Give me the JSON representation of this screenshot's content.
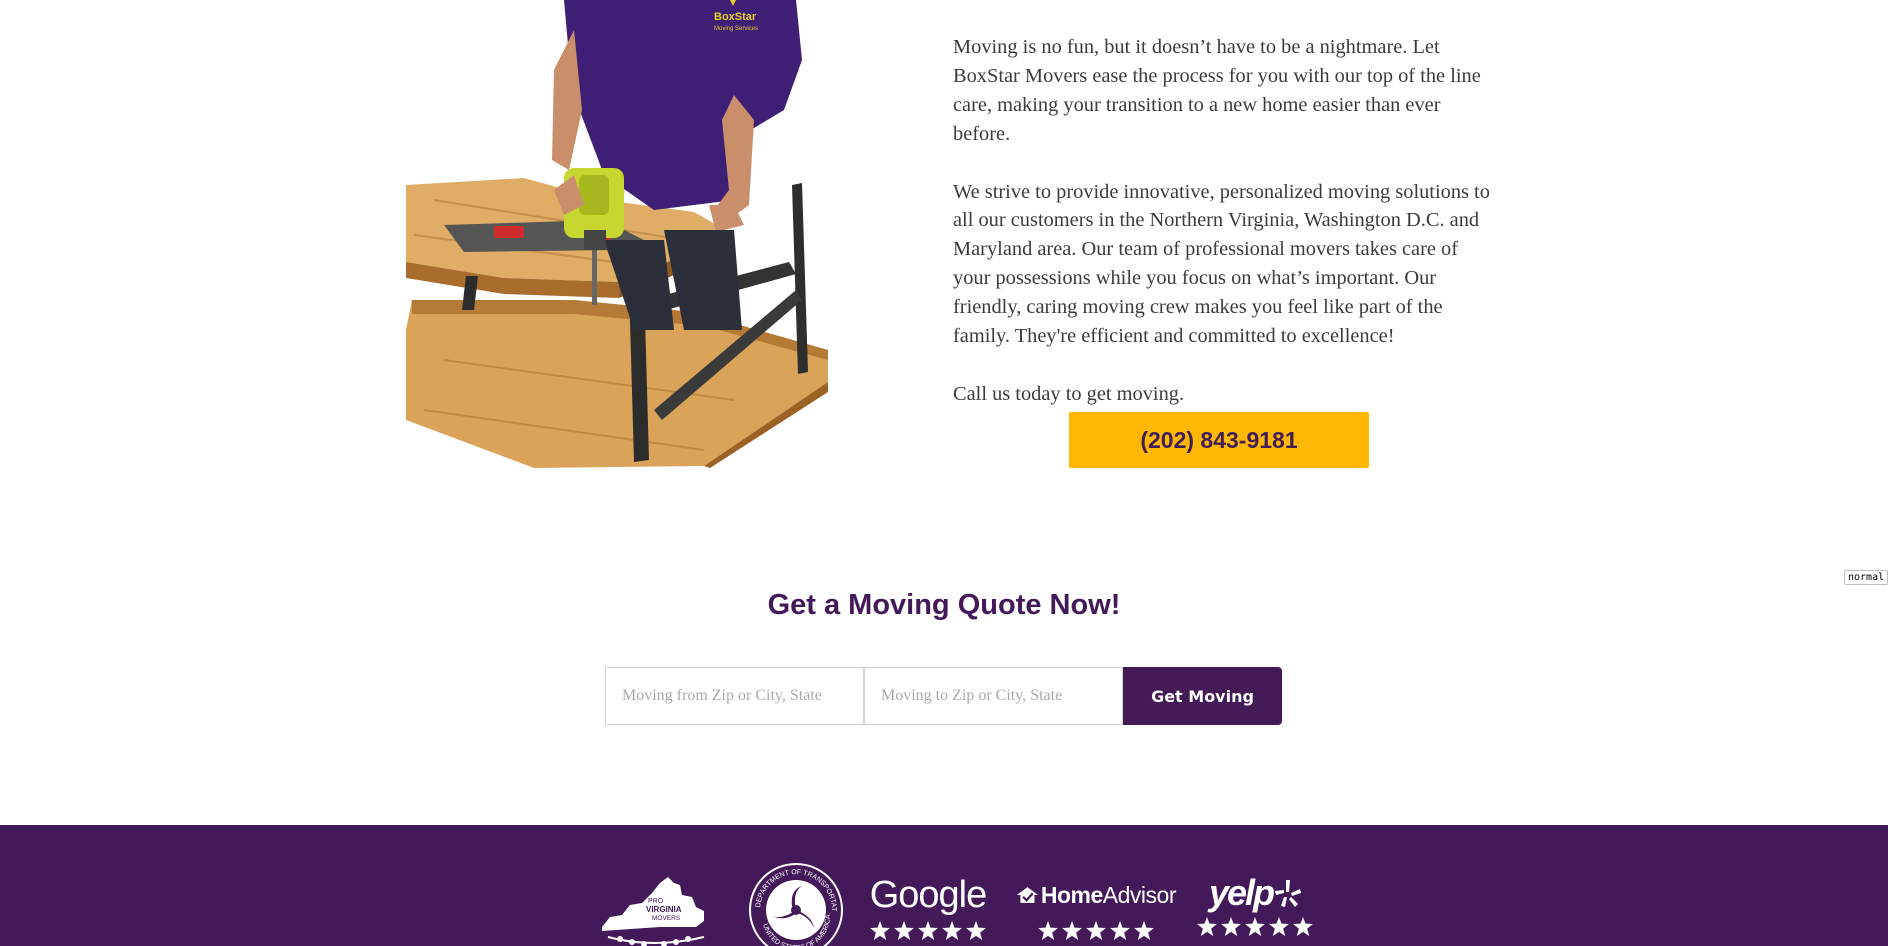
{
  "hero": {
    "image_alt": "Mover in BoxStar shirt assembling a wooden table with a power drill",
    "shirt_logo": "BoxStar",
    "shirt_sub": "Moving Services",
    "paragraphs": [
      "Moving is no fun, but it doesn’t have to be a nightmare. Let BoxStar Movers ease the process for you with our top of the line care, making your transition to a new home easier than ever before.",
      "We strive to provide innovative, personalized moving solutions to all our customers in the Northern Virginia, Washington D.C. and Maryland area. Our team of professional movers takes care of your possessions while you focus on what’s important. Our friendly, caring moving crew makes you feel like part of the family. They're efficient and committed to excellence!",
      "Call us today to get moving."
    ],
    "phone_label": "(202) 843-9181"
  },
  "quote": {
    "title": "Get a Moving Quote Now!",
    "from_placeholder": "Moving from Zip or City, State",
    "to_placeholder": "Moving to Zip or City, State",
    "submit_label": "Get Moving"
  },
  "debug_badge": "normal",
  "footer": {
    "badges": {
      "pro_virginia": {
        "line1": "PRO",
        "line2": "VIRGINIA",
        "line3": "MOVERS"
      },
      "dot": {
        "top_text": "DEPARTMENT OF TRANSPORTATION",
        "bottom_text": "UNITED STATES OF AMERICA"
      },
      "google": {
        "name": "Google",
        "stars": 5
      },
      "homeadvisor": {
        "name_bold": "Home",
        "name_regular": "Advisor",
        "stars": 5
      },
      "yelp": {
        "name": "yelp",
        "stars": 5
      }
    }
  },
  "colors": {
    "brand_purple": "#44195a",
    "accent_yellow": "#ffb703",
    "text_gray": "#3b3b3b"
  }
}
